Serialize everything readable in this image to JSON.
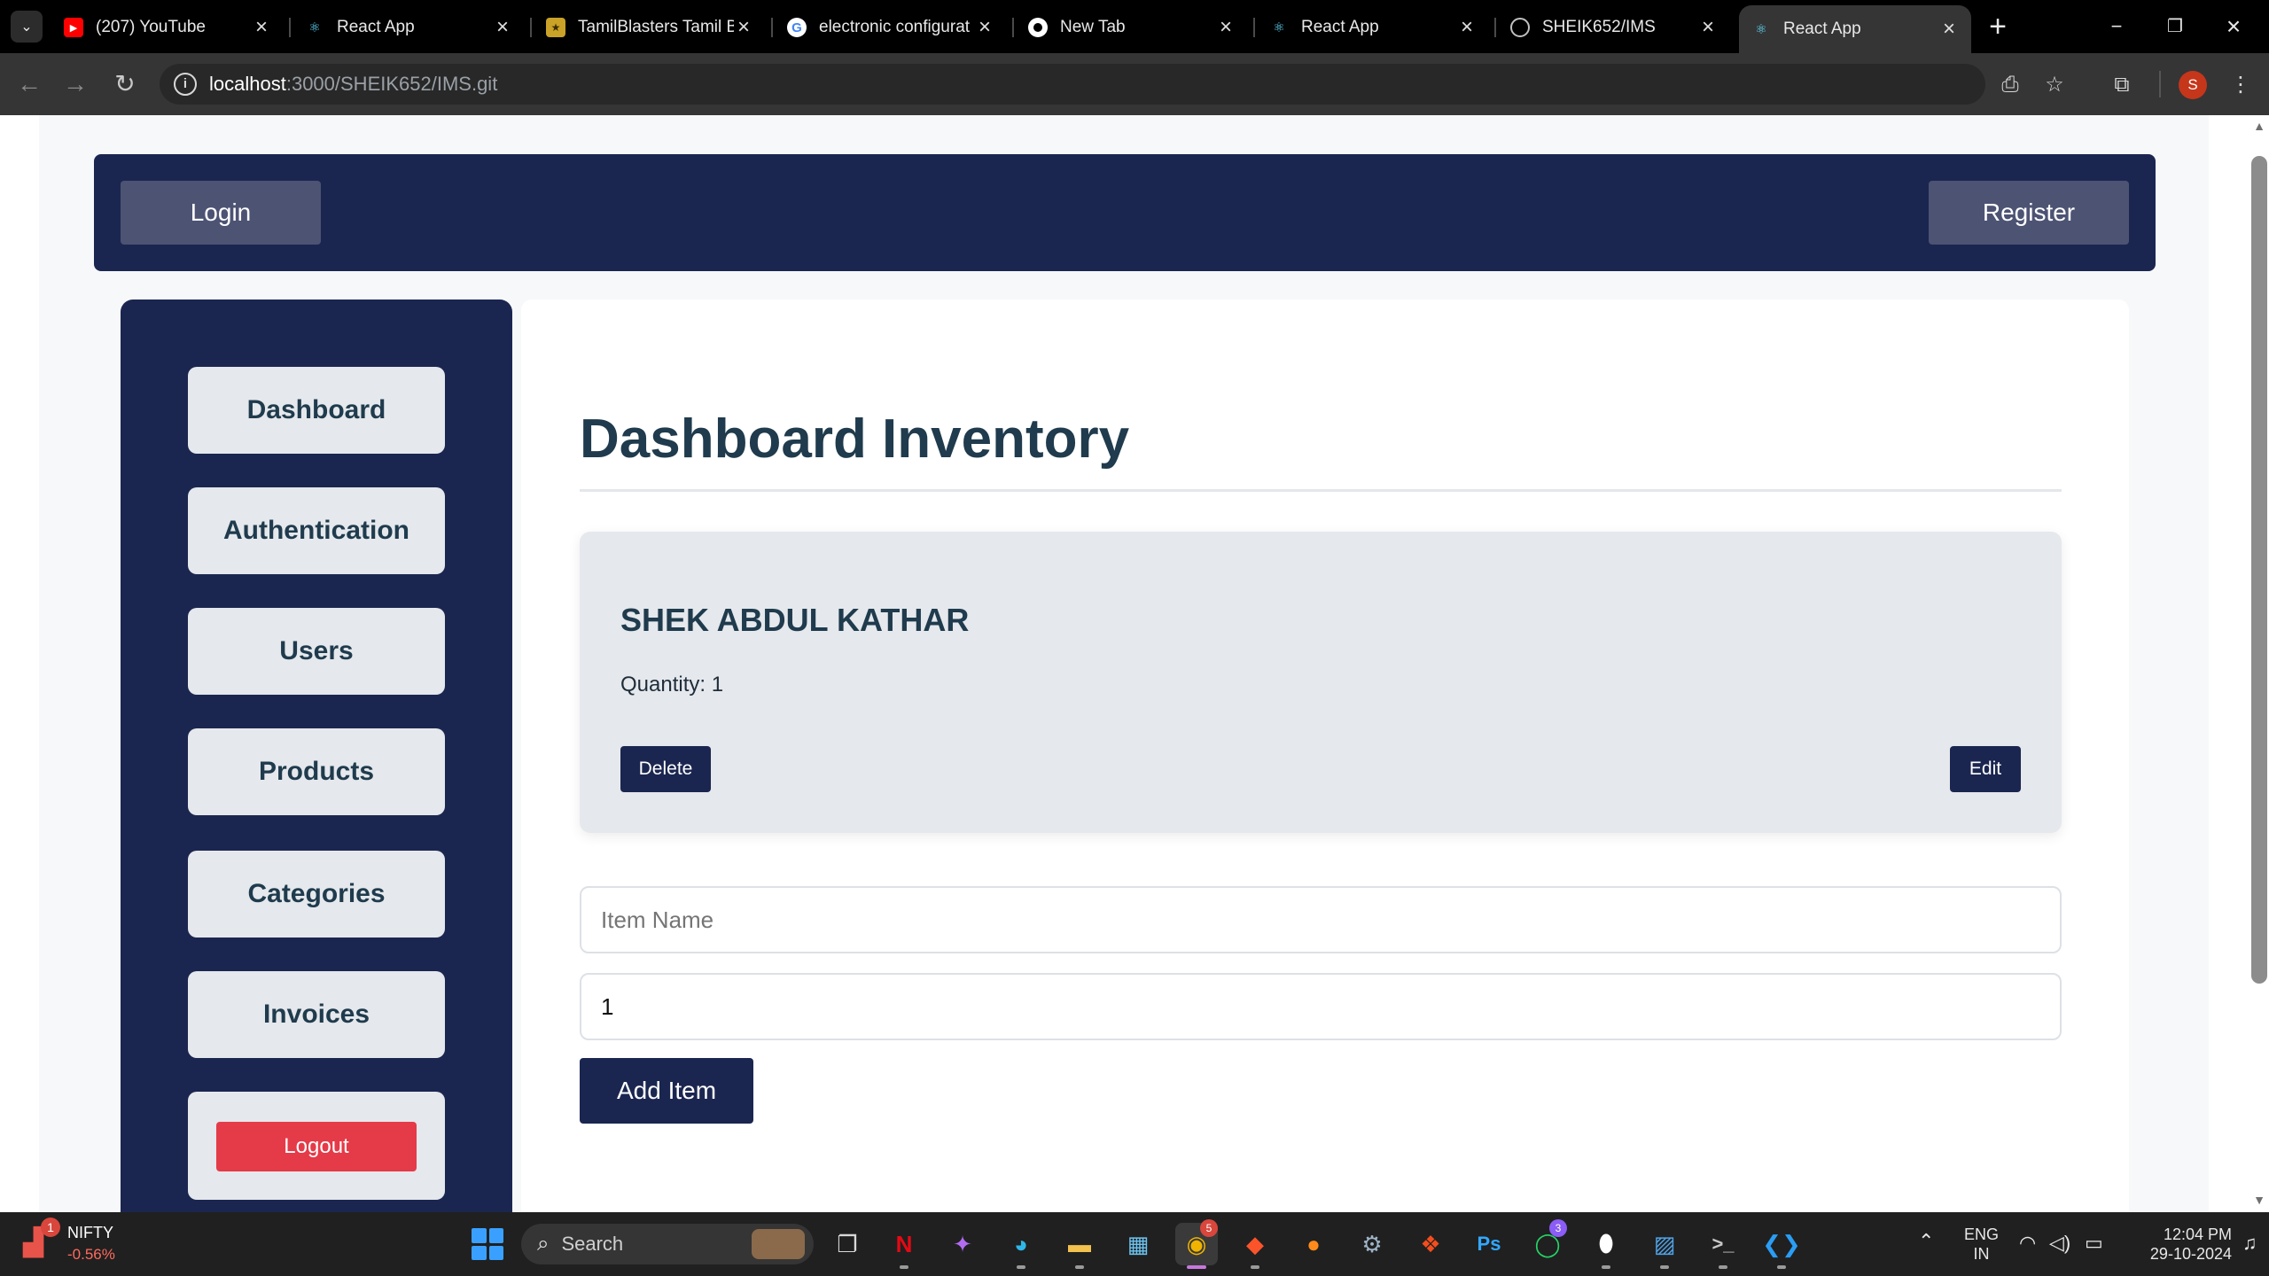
{
  "browser": {
    "tabs": [
      {
        "title": "(207) YouTube",
        "icon": "youtube-icon"
      },
      {
        "title": "React App",
        "icon": "react-icon"
      },
      {
        "title": "TamilBlasters Tamil B",
        "icon": "site-favicon-icon"
      },
      {
        "title": "electronic configurat",
        "icon": "google-icon"
      },
      {
        "title": "New Tab",
        "icon": "chrome-icon"
      },
      {
        "title": "React App",
        "icon": "react-icon"
      },
      {
        "title": "SHEIK652/IMS",
        "icon": "github-icon"
      },
      {
        "title": "React App",
        "icon": "react-icon"
      }
    ],
    "active_tab_index": 7,
    "url_host": "localhost",
    "url_rest": ":3000/SHEIK652/IMS.git",
    "profile_initial": "S"
  },
  "navbar": {
    "login_label": "Login",
    "register_label": "Register"
  },
  "sidebar": {
    "items": [
      {
        "label": "Dashboard"
      },
      {
        "label": "Authentication"
      },
      {
        "label": "Users"
      },
      {
        "label": "Products"
      },
      {
        "label": "Categories"
      },
      {
        "label": "Invoices"
      }
    ],
    "logout_label": "Logout"
  },
  "main": {
    "title": "Dashboard Inventory",
    "item": {
      "name": "SHEK ABDUL KATHAR",
      "quantity_text": "Quantity: 1",
      "delete_label": "Delete",
      "edit_label": "Edit"
    },
    "form": {
      "item_name_placeholder": "Item Name",
      "quantity_value": "1",
      "add_label": "Add Item"
    }
  },
  "taskbar": {
    "widget_name": "NIFTY",
    "widget_change": "-0.56%",
    "widget_badge": "1",
    "search_label": "Search",
    "chrome_badge": "5",
    "whatsapp_badge": "3",
    "lang_line1": "ENG",
    "lang_line2": "IN",
    "time": "12:04 PM",
    "date": "29-10-2024"
  },
  "colors": {
    "navy": "#1b2650",
    "panel_grey": "#e5e8ec",
    "logout_red": "#e53a48",
    "heading": "#1f3b4d"
  }
}
